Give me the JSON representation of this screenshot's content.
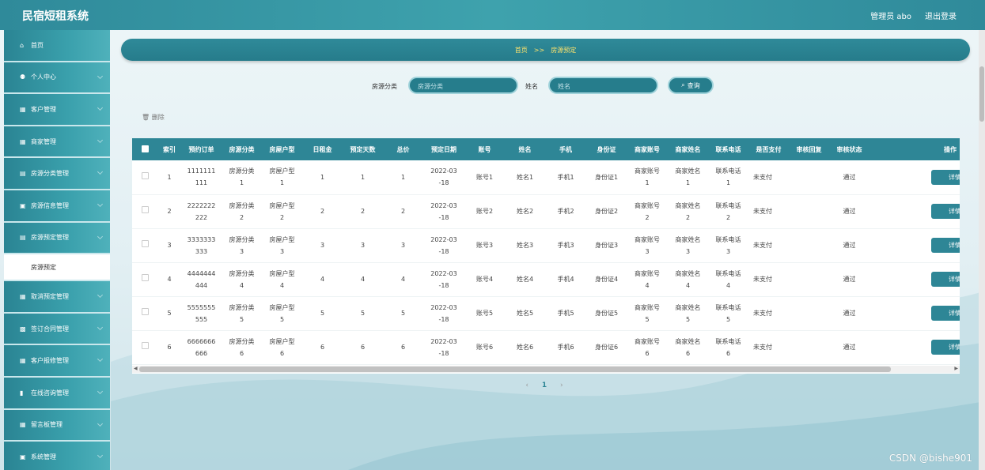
{
  "app": {
    "title": "民宿短租系统",
    "user": "管理员 abo",
    "logout": "退出登录"
  },
  "sidebar": {
    "items": [
      {
        "icon": "⌂",
        "icon_name": "home-icon",
        "label": "首页",
        "chevron": false
      },
      {
        "icon": "⚉",
        "icon_name": "user-icon",
        "label": "个人中心",
        "chevron": true
      },
      {
        "icon": "▦",
        "icon_name": "grid-icon",
        "label": "客户管理",
        "chevron": true
      },
      {
        "icon": "▦",
        "icon_name": "grid-icon",
        "label": "商家管理",
        "chevron": true
      },
      {
        "icon": "▤",
        "icon_name": "list-icon",
        "label": "房源分类管理",
        "chevron": true
      },
      {
        "icon": "▣",
        "icon_name": "doc-icon",
        "label": "房源信息管理",
        "chevron": true
      },
      {
        "icon": "▤",
        "icon_name": "list-icon",
        "label": "房源预定管理",
        "chevron": true
      },
      {
        "icon": "▦",
        "icon_name": "grid-icon",
        "label": "取消预定管理",
        "chevron": true
      },
      {
        "icon": "▩",
        "icon_name": "table-icon",
        "label": "签订合同管理",
        "chevron": true
      },
      {
        "icon": "▦",
        "icon_name": "grid-icon",
        "label": "客户报修管理",
        "chevron": true
      },
      {
        "icon": "▮",
        "icon_name": "chart-icon",
        "label": "在线咨询管理",
        "chevron": true
      },
      {
        "icon": "▦",
        "icon_name": "grid-icon",
        "label": "留言板管理",
        "chevron": true
      },
      {
        "icon": "▣",
        "icon_name": "settings-icon",
        "label": "系统管理",
        "chevron": true
      }
    ],
    "sub_item": "房源预定"
  },
  "breadcrumb": {
    "home": "首页",
    "sep": ">>",
    "current": "房源预定"
  },
  "search": {
    "category_label": "房源分类",
    "category_placeholder": "房源分类",
    "name_label": "姓名",
    "name_placeholder": "姓名",
    "button": "查询"
  },
  "toolbar": {
    "delete": "删除"
  },
  "table": {
    "headers": [
      "索引",
      "预约订单",
      "房源分类",
      "房屋户型",
      "日租金",
      "预定天数",
      "总价",
      "预定日期",
      "账号",
      "姓名",
      "手机",
      "身份证",
      "商家账号",
      "商家姓名",
      "联系电话",
      "是否支付",
      "审核回复",
      "审核状态",
      "操作"
    ],
    "rows": [
      {
        "idx": "1",
        "order": "1111111 111",
        "cat": "房源分类 1",
        "type": "房屋户型 1",
        "rent": "1",
        "days": "1",
        "total": "1",
        "date": "2022-03 -18",
        "account": "账号1",
        "name": "姓名1",
        "phone": "手机1",
        "idcard": "身份证1",
        "m_account": "商家账号 1",
        "m_name": "商家姓名 1",
        "m_phone": "联系电话 1",
        "paid": "未支付",
        "reply": "",
        "status": "通过"
      },
      {
        "idx": "2",
        "order": "2222222 222",
        "cat": "房源分类 2",
        "type": "房屋户型 2",
        "rent": "2",
        "days": "2",
        "total": "2",
        "date": "2022-03 -18",
        "account": "账号2",
        "name": "姓名2",
        "phone": "手机2",
        "idcard": "身份证2",
        "m_account": "商家账号 2",
        "m_name": "商家姓名 2",
        "m_phone": "联系电话 2",
        "paid": "未支付",
        "reply": "",
        "status": "通过"
      },
      {
        "idx": "3",
        "order": "3333333 333",
        "cat": "房源分类 3",
        "type": "房屋户型 3",
        "rent": "3",
        "days": "3",
        "total": "3",
        "date": "2022-03 -18",
        "account": "账号3",
        "name": "姓名3",
        "phone": "手机3",
        "idcard": "身份证3",
        "m_account": "商家账号 3",
        "m_name": "商家姓名 3",
        "m_phone": "联系电话 3",
        "paid": "未支付",
        "reply": "",
        "status": "通过"
      },
      {
        "idx": "4",
        "order": "4444444 444",
        "cat": "房源分类 4",
        "type": "房屋户型 4",
        "rent": "4",
        "days": "4",
        "total": "4",
        "date": "2022-03 -18",
        "account": "账号4",
        "name": "姓名4",
        "phone": "手机4",
        "idcard": "身份证4",
        "m_account": "商家账号 4",
        "m_name": "商家姓名 4",
        "m_phone": "联系电话 4",
        "paid": "未支付",
        "reply": "",
        "status": "通过"
      },
      {
        "idx": "5",
        "order": "5555555 555",
        "cat": "房源分类 5",
        "type": "房屋户型 5",
        "rent": "5",
        "days": "5",
        "total": "5",
        "date": "2022-03 -18",
        "account": "账号5",
        "name": "姓名5",
        "phone": "手机5",
        "idcard": "身份证5",
        "m_account": "商家账号 5",
        "m_name": "商家姓名 5",
        "m_phone": "联系电话 5",
        "paid": "未支付",
        "reply": "",
        "status": "通过"
      },
      {
        "idx": "6",
        "order": "6666666 666",
        "cat": "房源分类 6",
        "type": "房屋户型 6",
        "rent": "6",
        "days": "6",
        "total": "6",
        "date": "2022-03 -18",
        "account": "账号6",
        "name": "姓名6",
        "phone": "手机6",
        "idcard": "身份证6",
        "m_account": "商家账号 6",
        "m_name": "商家姓名 6",
        "m_phone": "联系电话 6",
        "paid": "未支付",
        "reply": "",
        "status": "通过"
      }
    ],
    "detail_button": "详情"
  },
  "pagination": {
    "prev": "‹",
    "current": "1",
    "next": "›"
  },
  "watermark": "CSDN @bishe901",
  "colors": {
    "primary": "#2e8696",
    "topbar": "#3ea2ad",
    "accent": "#ffe36b"
  }
}
